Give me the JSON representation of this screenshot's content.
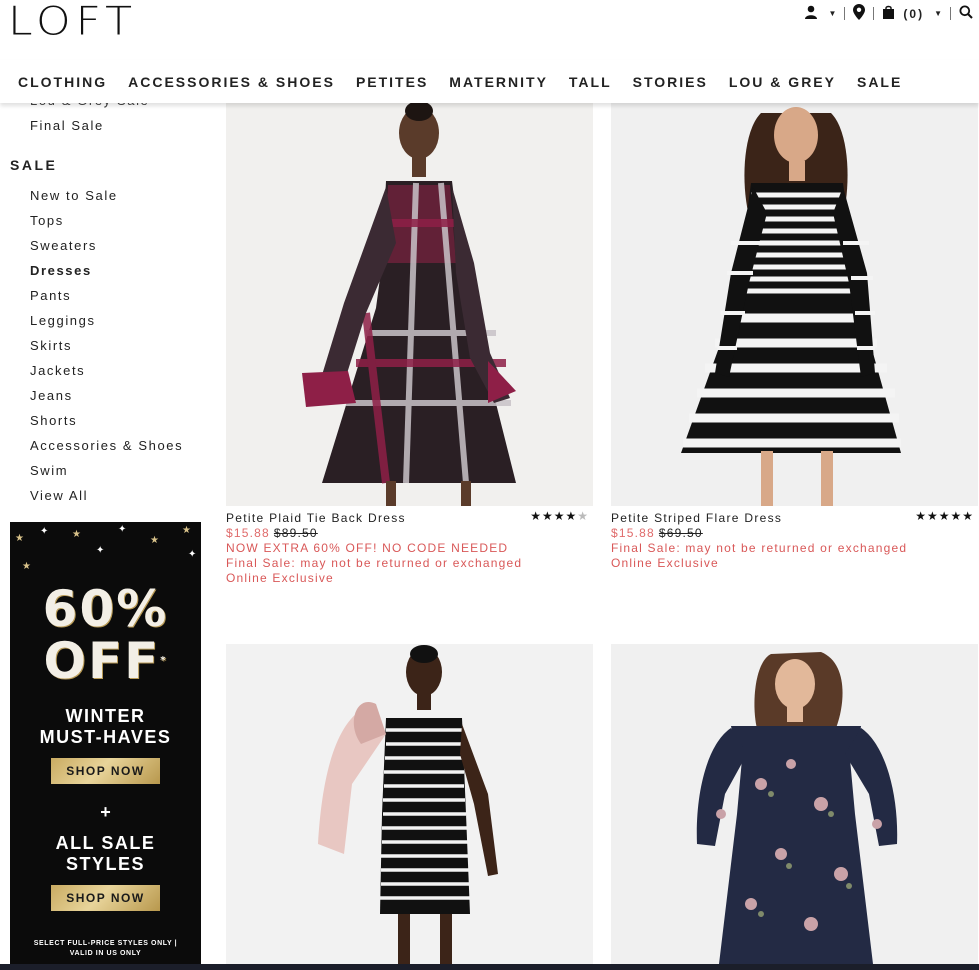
{
  "brand": {
    "logo": "LOFT"
  },
  "header": {
    "cart_count": "(0)"
  },
  "nav": [
    "CLOTHING",
    "ACCESSORIES & SHOES",
    "PETITES",
    "MATERNITY",
    "TALL",
    "STORIES",
    "LOU & GREY",
    "SALE"
  ],
  "sidebar": {
    "partial_item": "Lou & Grey Sale",
    "final_sale": "Final Sale",
    "heading": "SALE",
    "items": [
      "New to Sale",
      "Tops",
      "Sweaters",
      "Dresses",
      "Pants",
      "Leggings",
      "Skirts",
      "Jackets",
      "Jeans",
      "Shorts",
      "Accessories & Shoes",
      "Swim",
      "View All"
    ],
    "active": "Dresses"
  },
  "promo": {
    "line1": "60%",
    "line2": "OFF",
    "asterisk": "*",
    "title1a": "WINTER",
    "title1b": "MUST-HAVES",
    "button1": "SHOP NOW",
    "plus": "+",
    "title2a": "ALL SALE",
    "title2b": "STYLES",
    "button2": "SHOP NOW",
    "fine1": "SELECT FULL-PRICE STYLES ONLY |",
    "fine2": "VALID IN US ONLY"
  },
  "products": [
    {
      "name": "Petite Plaid Tie Back Dress",
      "rating": 4,
      "rating_max": 5,
      "sale_price": "$15.88",
      "original_price": "$89.50",
      "notes": [
        "NOW EXTRA 60% OFF! NO CODE NEEDED",
        "Final Sale: may not be returned or exchanged",
        "Online Exclusive"
      ]
    },
    {
      "name": "Petite Striped Flare Dress",
      "rating": 5,
      "rating_max": 5,
      "sale_price": "$15.88",
      "original_price": "$69.50",
      "notes": [
        "Final Sale: may not be returned or exchanged",
        "Online Exclusive"
      ]
    },
    {
      "name": "",
      "rating": 0
    },
    {
      "name": "",
      "rating": 0
    }
  ],
  "colors": {
    "sale_red": "#e06b6b",
    "gold": "#c9ab62",
    "promo_bg": "#0b0b0b"
  },
  "icons": [
    "user-icon",
    "location-pin-icon",
    "shopping-bag-icon",
    "search-icon"
  ]
}
